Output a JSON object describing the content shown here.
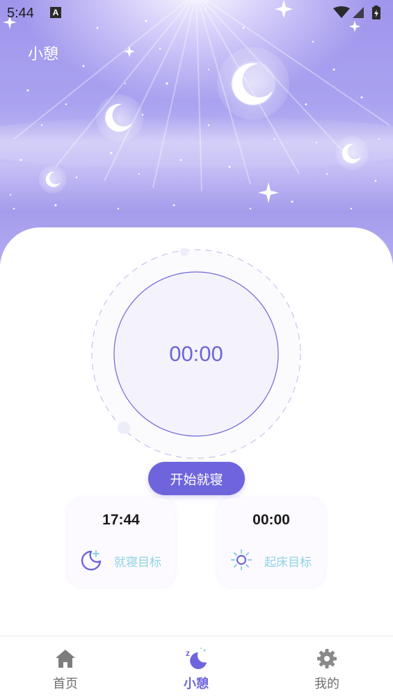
{
  "status_bar": {
    "time": "5:44",
    "notification_badge": "A"
  },
  "header": {
    "title": "小憩"
  },
  "timer": {
    "display": "00:00"
  },
  "actions": {
    "start_label": "开始就寝"
  },
  "cards": {
    "bedtime": {
      "time": "17:44",
      "label": "就寝目标",
      "icon": "moon-plus-icon"
    },
    "wake": {
      "time": "00:00",
      "label": "起床目标",
      "icon": "sun-icon"
    }
  },
  "tabs": [
    {
      "label": "首页",
      "icon": "home-icon"
    },
    {
      "label": "小憩",
      "icon": "sleep-moon-icon"
    },
    {
      "label": "我的",
      "icon": "gear-icon"
    }
  ],
  "colors": {
    "accent": "#6e65dc",
    "card_label": "#8fd3e4",
    "tab_inactive": "#6e6e6e"
  }
}
